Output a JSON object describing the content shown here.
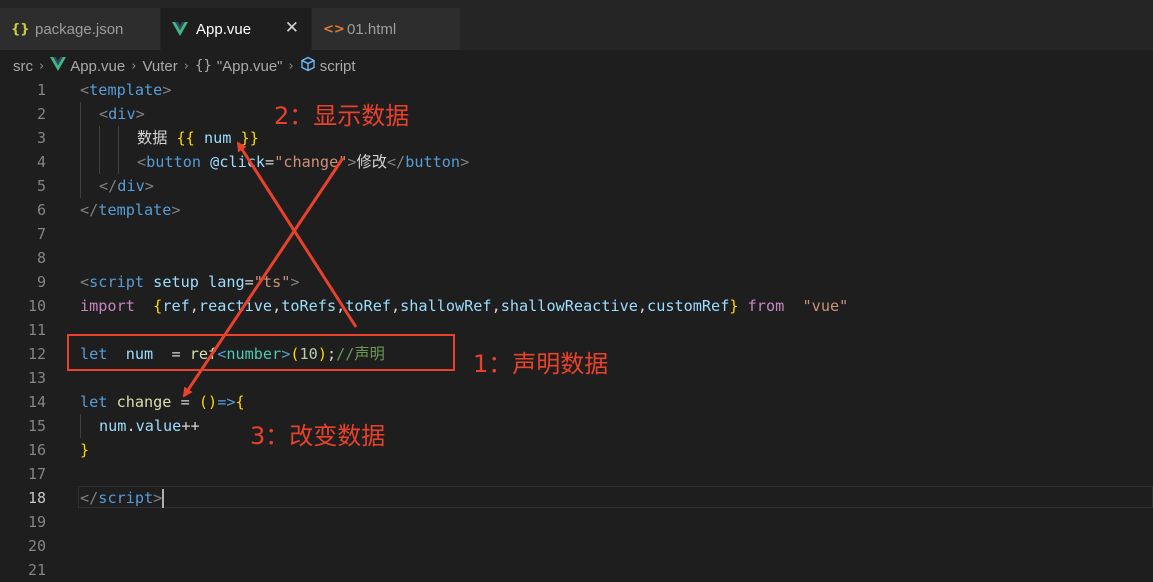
{
  "tabs": [
    {
      "icon": "{}",
      "label": "package.json",
      "active": false
    },
    {
      "icon": "vue",
      "label": "App.vue",
      "active": true,
      "close": "✕"
    },
    {
      "icon": "<>",
      "label": "01.html",
      "active": false
    }
  ],
  "breadcrumb": [
    "src",
    "App.vue",
    "Vuter",
    "\"App.vue\"",
    "script"
  ],
  "breadcrumb_glyphs": {
    "separator": "›",
    "braces": "{}"
  },
  "editor": {
    "active_line": 18,
    "line_numbers": [
      "1",
      "2",
      "3",
      "4",
      "5",
      "6",
      "7",
      "8",
      "9",
      "10",
      "11",
      "12",
      "13",
      "14",
      "15",
      "16",
      "17",
      "18",
      "19",
      "20",
      "21"
    ],
    "code": {
      "l1": [
        "<",
        "template",
        ">"
      ],
      "l2": [
        "<",
        "div",
        ">"
      ],
      "l3": [
        "数据 ",
        "{{",
        " num ",
        "}}"
      ],
      "l4": [
        "<",
        "button",
        " @click",
        "=",
        "\"change\"",
        ">",
        "修改",
        "</",
        "button",
        ">"
      ],
      "l5": [
        "</",
        "div",
        ">"
      ],
      "l6": [
        "</",
        "template",
        ">"
      ],
      "l9": [
        "<",
        "script",
        " setup",
        " lang",
        "=",
        "\"ts\"",
        ">"
      ],
      "l10": [
        "import",
        "  ",
        "{",
        "ref",
        ",",
        "reactive",
        ",",
        "toRefs",
        ",",
        "toRef",
        ",",
        "shallowRef",
        ",",
        "shallowReactive",
        ",",
        "customRef",
        "}",
        " ",
        "from",
        "  ",
        "\"vue\""
      ],
      "l12": [
        "let",
        "  ",
        "num",
        "  = ",
        "ref",
        "<",
        "number",
        ">",
        "(",
        "10",
        ")",
        ";",
        "//声明"
      ],
      "l14": [
        "let",
        " ",
        "change",
        " = ",
        "()",
        "=>",
        "{"
      ],
      "l15": [
        "num",
        ".",
        "value",
        "++"
      ],
      "l16": [
        "}"
      ],
      "l18": [
        "</",
        "script",
        ">"
      ]
    }
  },
  "annotations": {
    "a1": "1：声明数据",
    "a2": "2：显示数据",
    "a3": "3：改变数据"
  },
  "colors": {
    "annotation": "#e8412c",
    "background": "#1e1e1e",
    "keyword": "#569cd6"
  }
}
